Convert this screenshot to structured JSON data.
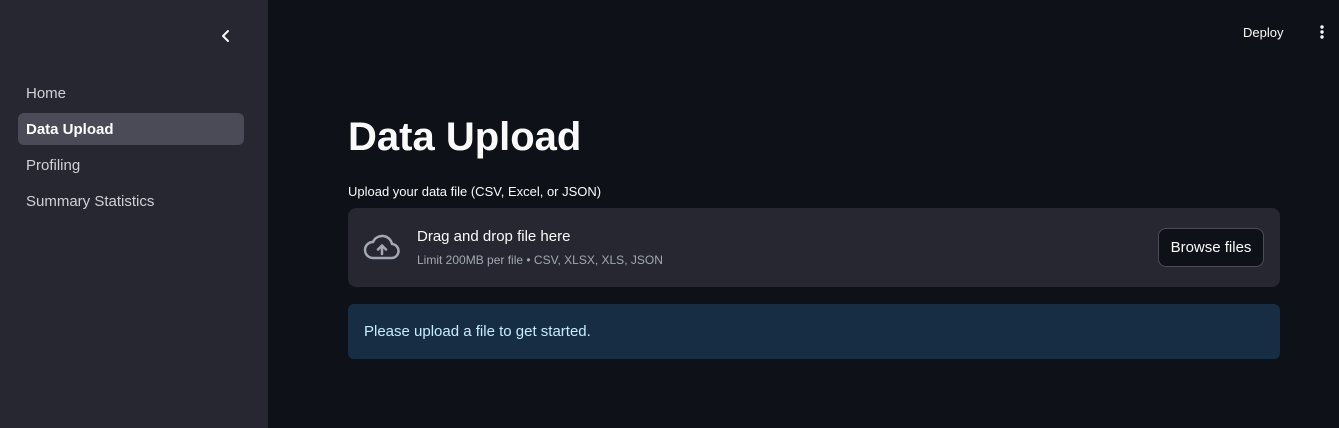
{
  "sidebar": {
    "collapse_icon": "chevron-left-icon",
    "items": [
      {
        "label": "Home"
      },
      {
        "label": "Data Upload",
        "active": true
      },
      {
        "label": "Profiling"
      },
      {
        "label": "Summary Statistics"
      }
    ]
  },
  "header": {
    "deploy_label": "Deploy",
    "menu_icon": "vertical-dots-icon"
  },
  "main": {
    "title": "Data Upload",
    "uploader": {
      "label": "Upload your data file (CSV, Excel, or JSON)",
      "icon": "cloud-upload-icon",
      "drop_text": "Drag and drop file here",
      "limit_text": "Limit 200MB per file • CSV, XLSX, XLS, JSON",
      "browse_label": "Browse files"
    },
    "info_message": "Please upload a file to get started."
  },
  "colors": {
    "background": "#0e1117",
    "sidebar": "#262730",
    "active_nav": "#4a4b57",
    "info_bg": "#172d43",
    "info_text": "#c7ebff"
  }
}
